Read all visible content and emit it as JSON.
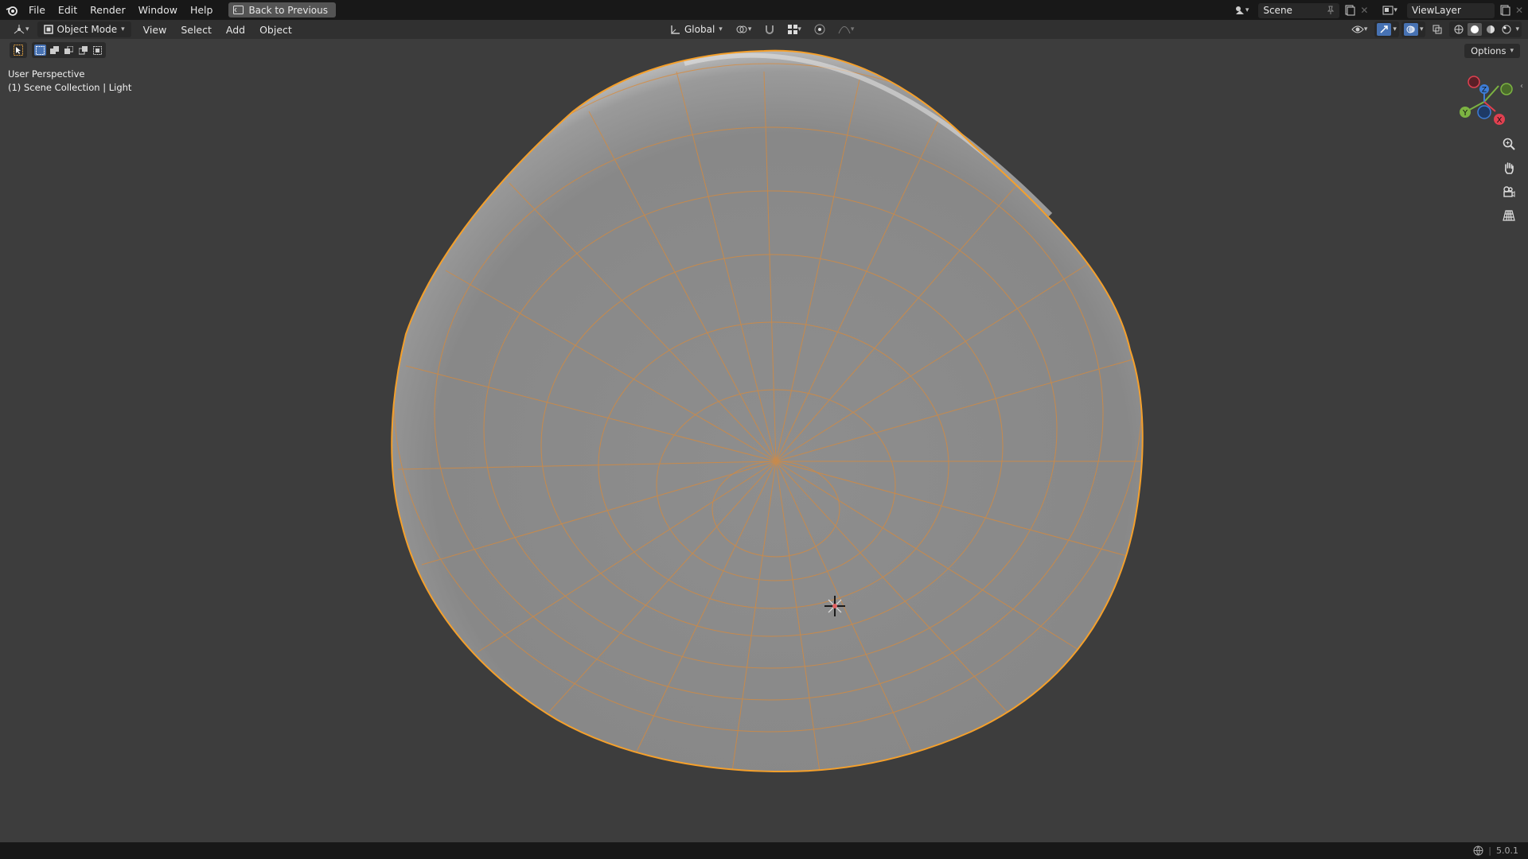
{
  "topbar": {
    "menus": [
      "File",
      "Edit",
      "Render",
      "Window",
      "Help"
    ],
    "back_label": "Back to Previous",
    "scene_name": "Scene",
    "view_layer_name": "ViewLayer"
  },
  "header": {
    "mode_label": "Object Mode",
    "menus": [
      "View",
      "Select",
      "Add",
      "Object"
    ],
    "orientation_label": "Global",
    "options_label": "Options"
  },
  "viewport": {
    "perspective_label": "User Perspective",
    "collection_label": "(1) Scene Collection | Light",
    "gizmo_axes": {
      "x": "X",
      "y": "Y",
      "z": "Z"
    },
    "object_color": "#8a8a8a",
    "wire_color": "#e8842a"
  },
  "statusbar": {
    "version": "5.0.1"
  },
  "colors": {
    "accent": "#4772b3",
    "background": "#3d3d3d",
    "selection_outline": "#f5a02b"
  }
}
